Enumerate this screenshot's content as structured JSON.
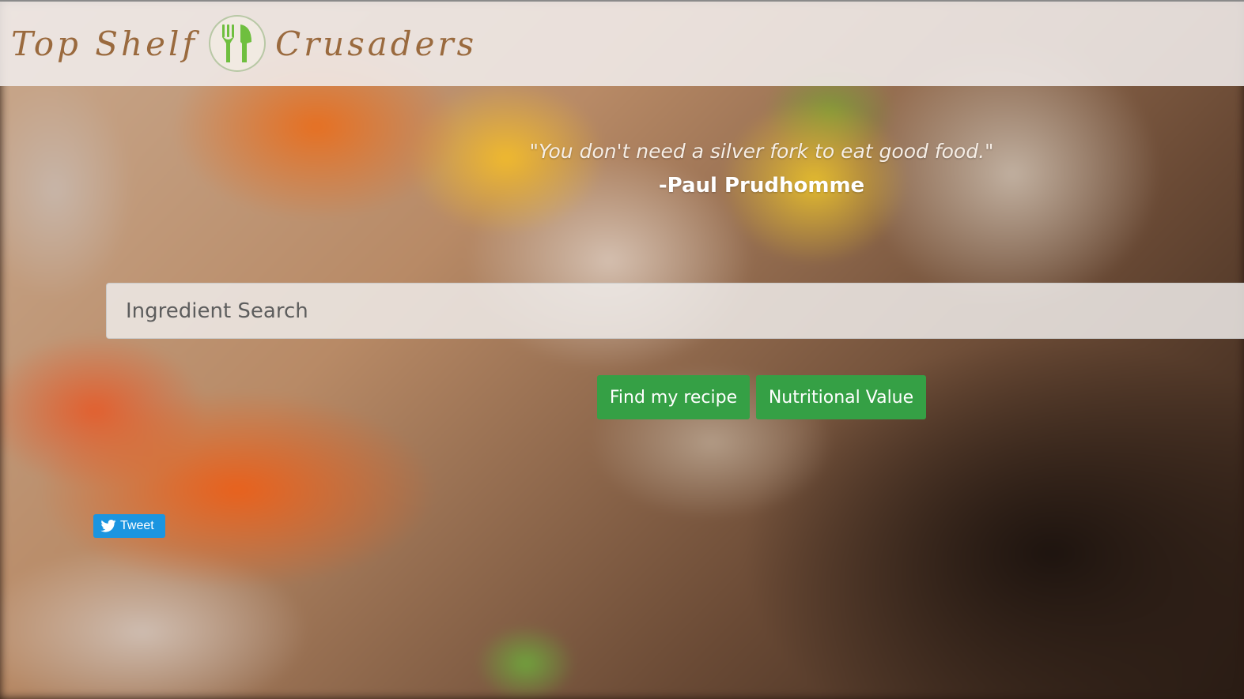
{
  "header": {
    "brand_left": "Top Shelf",
    "brand_right": "Crusaders",
    "logo_icon": "fork-knife-icon",
    "logo_color": "#6fbf3f",
    "brand_color": "#9a6a3e"
  },
  "hero": {
    "quote": "\"You don't need a silver fork to eat good food.\"",
    "author": "-Paul Prudhomme"
  },
  "search": {
    "placeholder": "Ingredient Search",
    "value": ""
  },
  "actions": {
    "find_label": "Find my recipe",
    "nutrition_label": "Nutritional Value",
    "button_color": "#35a045"
  },
  "social": {
    "tweet_label": "Tweet",
    "tweet_icon": "twitter-bird-icon",
    "tweet_color": "#1b95e0"
  }
}
